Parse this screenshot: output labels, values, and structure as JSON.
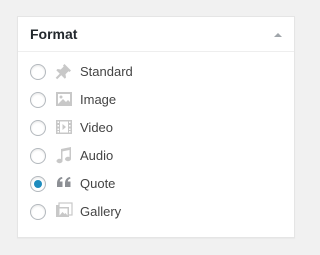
{
  "box": {
    "title": "Format",
    "toggle_icon": "triangle-up-icon"
  },
  "formats": [
    {
      "label": "Standard",
      "icon": "pin-icon",
      "checked": false
    },
    {
      "label": "Image",
      "icon": "image-icon",
      "checked": false
    },
    {
      "label": "Video",
      "icon": "video-icon",
      "checked": false
    },
    {
      "label": "Audio",
      "icon": "music-note-icon",
      "checked": false
    },
    {
      "label": "Quote",
      "icon": "quote-icon",
      "checked": true
    },
    {
      "label": "Gallery",
      "icon": "gallery-icon",
      "checked": false
    }
  ],
  "colors": {
    "accent": "#1e8cbe",
    "icon": "#c8c8c8",
    "title": "#23282d",
    "label": "#444444"
  }
}
